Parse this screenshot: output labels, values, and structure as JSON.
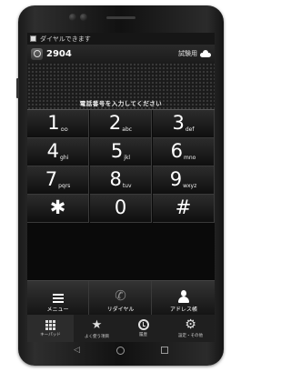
{
  "status": {
    "text": "ダイヤルできます"
  },
  "header": {
    "extension": "2904",
    "mode": "試験用"
  },
  "prompt": "電話番号を入力してください",
  "keypad": {
    "keys": [
      {
        "digit": "1",
        "sub": "ᴑᴑ"
      },
      {
        "digit": "2",
        "sub": "abc"
      },
      {
        "digit": "3",
        "sub": "def"
      },
      {
        "digit": "4",
        "sub": "ghi"
      },
      {
        "digit": "5",
        "sub": "jkl"
      },
      {
        "digit": "6",
        "sub": "mno"
      },
      {
        "digit": "7",
        "sub": "pqrs"
      },
      {
        "digit": "8",
        "sub": "tuv"
      },
      {
        "digit": "9",
        "sub": "wxyz"
      },
      {
        "digit": "✱",
        "sub": ""
      },
      {
        "digit": "0",
        "sub": ""
      },
      {
        "digit": "#",
        "sub": ""
      }
    ]
  },
  "actions": {
    "menu": "メニュー",
    "redial": "リダイヤル",
    "contacts": "アドレス帳"
  },
  "tabs": [
    {
      "label": "キーパッド",
      "icon": "keypad-icon"
    },
    {
      "label": "よく使う項目",
      "icon": "star-icon"
    },
    {
      "label": "履歴",
      "icon": "clock-icon"
    },
    {
      "label": "設定・その他",
      "icon": "gear-icon"
    }
  ]
}
